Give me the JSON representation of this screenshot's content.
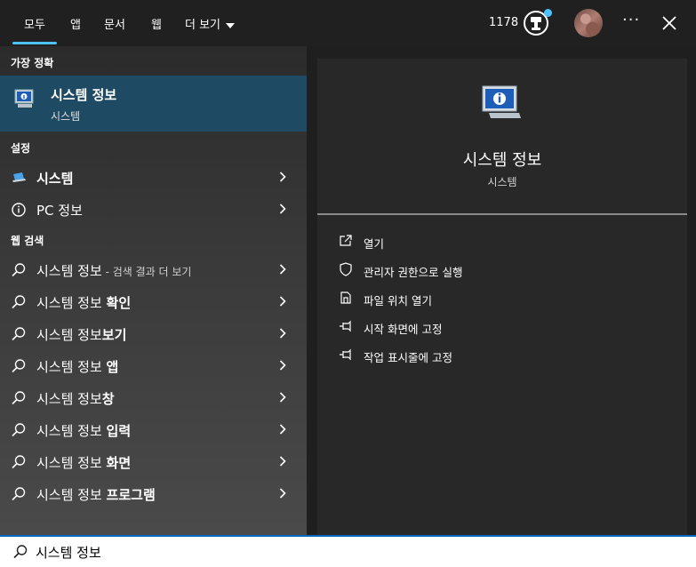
{
  "tabs": [
    {
      "label": "모두"
    },
    {
      "label": "앱"
    },
    {
      "label": "문서"
    },
    {
      "label": "웹"
    },
    {
      "label": "더 보기"
    }
  ],
  "header": {
    "points": "1178",
    "accent": "#4cc2ff",
    "icons": [
      "rewards-icon",
      "avatar",
      "more-icon",
      "close-icon"
    ]
  },
  "left": {
    "best_section": "가장 정확",
    "best_match": {
      "title": "시스템 정보",
      "subtitle": "시스템",
      "highlight": "#1e4a63"
    },
    "settings_section": "설정",
    "settings": [
      {
        "label": "시스템"
      },
      {
        "label": "PC 정보"
      }
    ],
    "web_section": "웹 검색",
    "web": [
      {
        "base": "시스템 정보",
        "suffix": " - 검색 결과 더 보기"
      },
      {
        "base": "시스템 정보 ",
        "bold": "확인"
      },
      {
        "base": "시스템 정보",
        "bold": "보기"
      },
      {
        "base": "시스템 정보 ",
        "bold": "앱"
      },
      {
        "base": "시스템 정보",
        "bold": "창"
      },
      {
        "base": "시스템 정보 ",
        "bold": "입력"
      },
      {
        "base": "시스템 정보 ",
        "bold": "화면"
      },
      {
        "base": "시스템 정보 ",
        "bold": "프로그램"
      }
    ]
  },
  "right": {
    "title": "시스템 정보",
    "subtitle": "시스템",
    "actions": [
      {
        "label": "열기",
        "icon": "open-icon"
      },
      {
        "label": "관리자 권한으로 실행",
        "icon": "shield-icon"
      },
      {
        "label": "파일 위치 열기",
        "icon": "file-location-icon"
      },
      {
        "label": "시작 화면에 고정",
        "icon": "pin-icon"
      },
      {
        "label": "작업 표시줄에 고정",
        "icon": "pin-icon"
      }
    ]
  },
  "search": {
    "value": "시스템 정보"
  }
}
